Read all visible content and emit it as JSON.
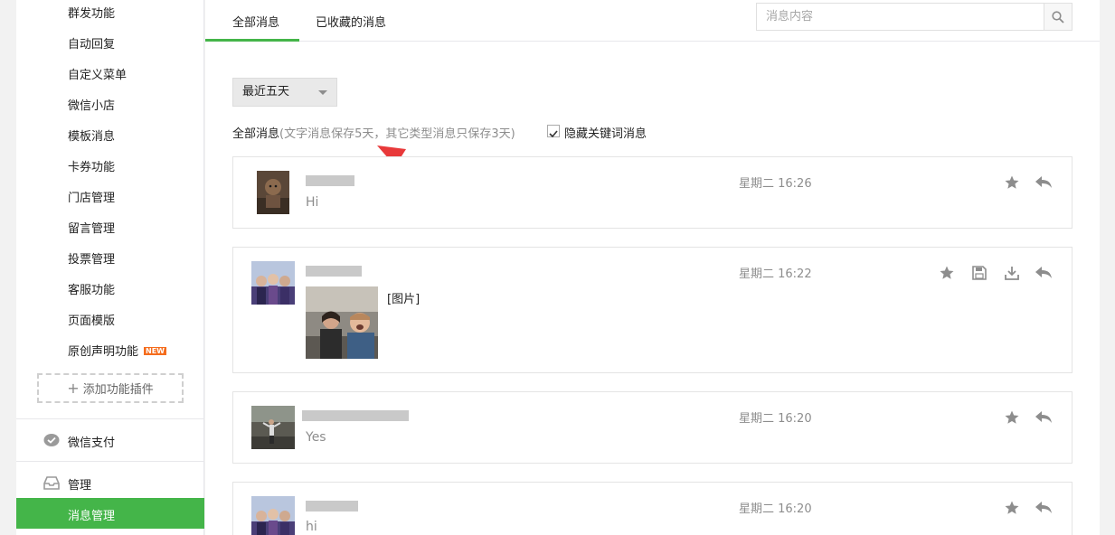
{
  "sidebar": {
    "items": [
      "群发功能",
      "自动回复",
      "自定义菜单",
      "微信小店",
      "模板消息",
      "卡券功能",
      "门店管理",
      "留言管理",
      "投票管理",
      "客服功能",
      "页面模版",
      "原创声明功能"
    ],
    "new_badge": "NEW",
    "add_plugin": "添加功能插件",
    "section_pay": "微信支付",
    "section_manage": "管理",
    "active_item": "消息管理"
  },
  "tabs": {
    "all": "全部消息",
    "starred": "已收藏的消息"
  },
  "search": {
    "placeholder": "消息内容"
  },
  "filter": {
    "selected": "最近五天"
  },
  "info": {
    "label": "全部消息",
    "note": "(文字消息保存5天，其它类型消息只保存3天)",
    "hide_keyword": "隐藏关键词消息",
    "hide_keyword_checked": true
  },
  "messages": [
    {
      "time": "星期二 16:26",
      "text": "Hi",
      "actions": [
        "star-icon",
        "reply-icon"
      ]
    },
    {
      "time": "星期二 16:22",
      "text": "[图片]",
      "actions": [
        "star-icon",
        "save-icon",
        "download-icon",
        "reply-icon"
      ]
    },
    {
      "time": "星期二 16:20",
      "text": "Yes",
      "actions": [
        "star-icon",
        "reply-icon"
      ]
    },
    {
      "time": "星期二 16:20",
      "text": "hi",
      "actions": [
        "star-icon",
        "reply-icon"
      ]
    }
  ],
  "colors": {
    "accent": "#44b549",
    "annotation": "#e8393a",
    "badge": "#f56c1c"
  }
}
